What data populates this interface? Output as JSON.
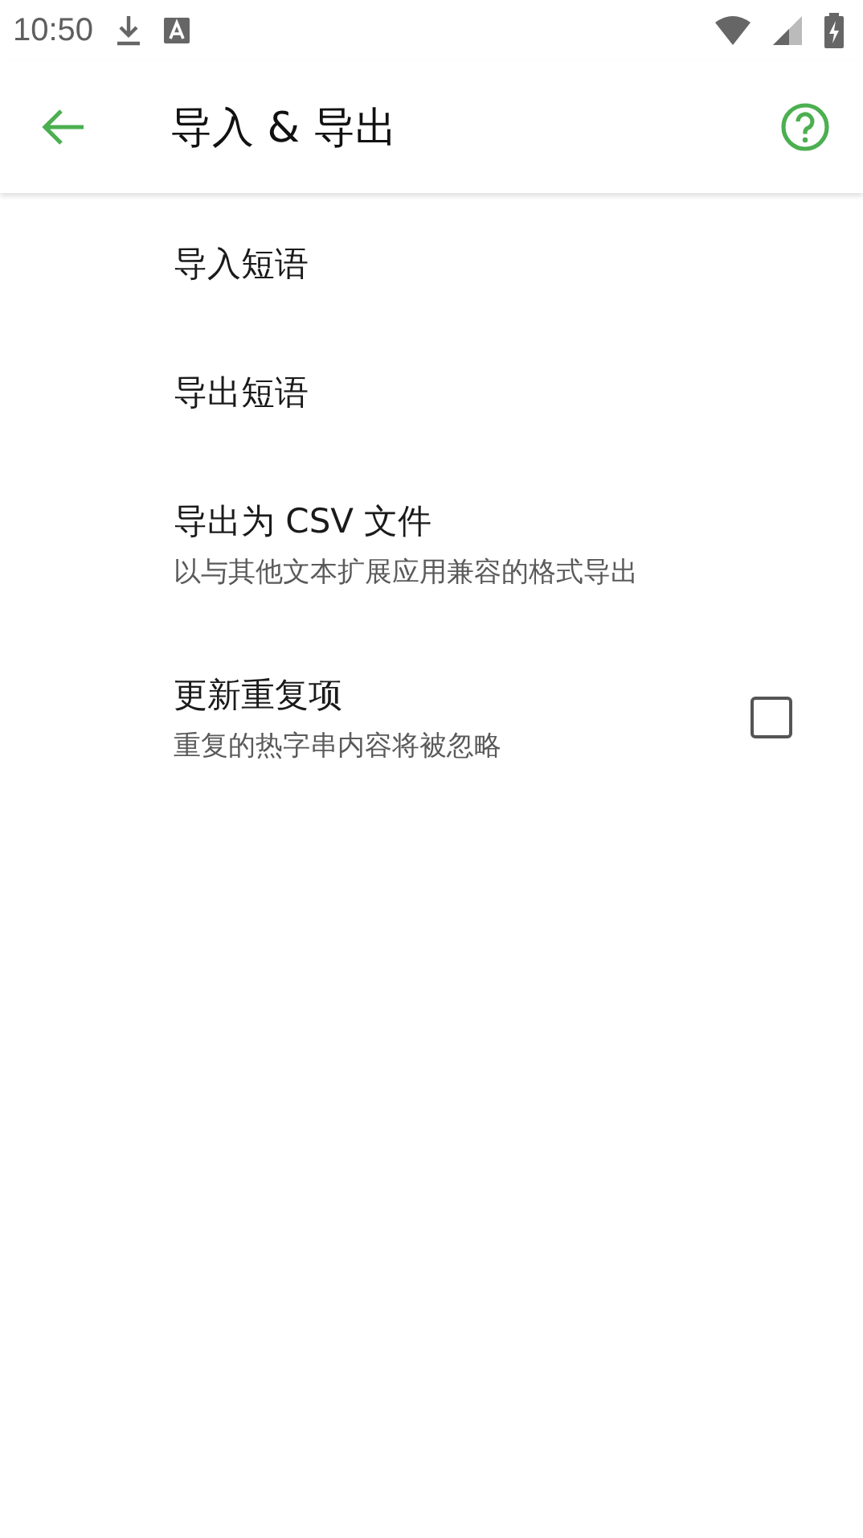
{
  "status_bar": {
    "time": "10:50"
  },
  "app_bar": {
    "title": "导入 & 导出"
  },
  "items": [
    {
      "kind": "plain",
      "title": "导入短语"
    },
    {
      "kind": "plain",
      "title": "导出短语"
    },
    {
      "kind": "plain",
      "title": "导出为 CSV 文件",
      "subtitle": "以与其他文本扩展应用兼容的格式导出"
    },
    {
      "kind": "checkbox",
      "title": "更新重复项",
      "subtitle": "重复的热字串内容将被忽略",
      "checked": false
    }
  ]
}
